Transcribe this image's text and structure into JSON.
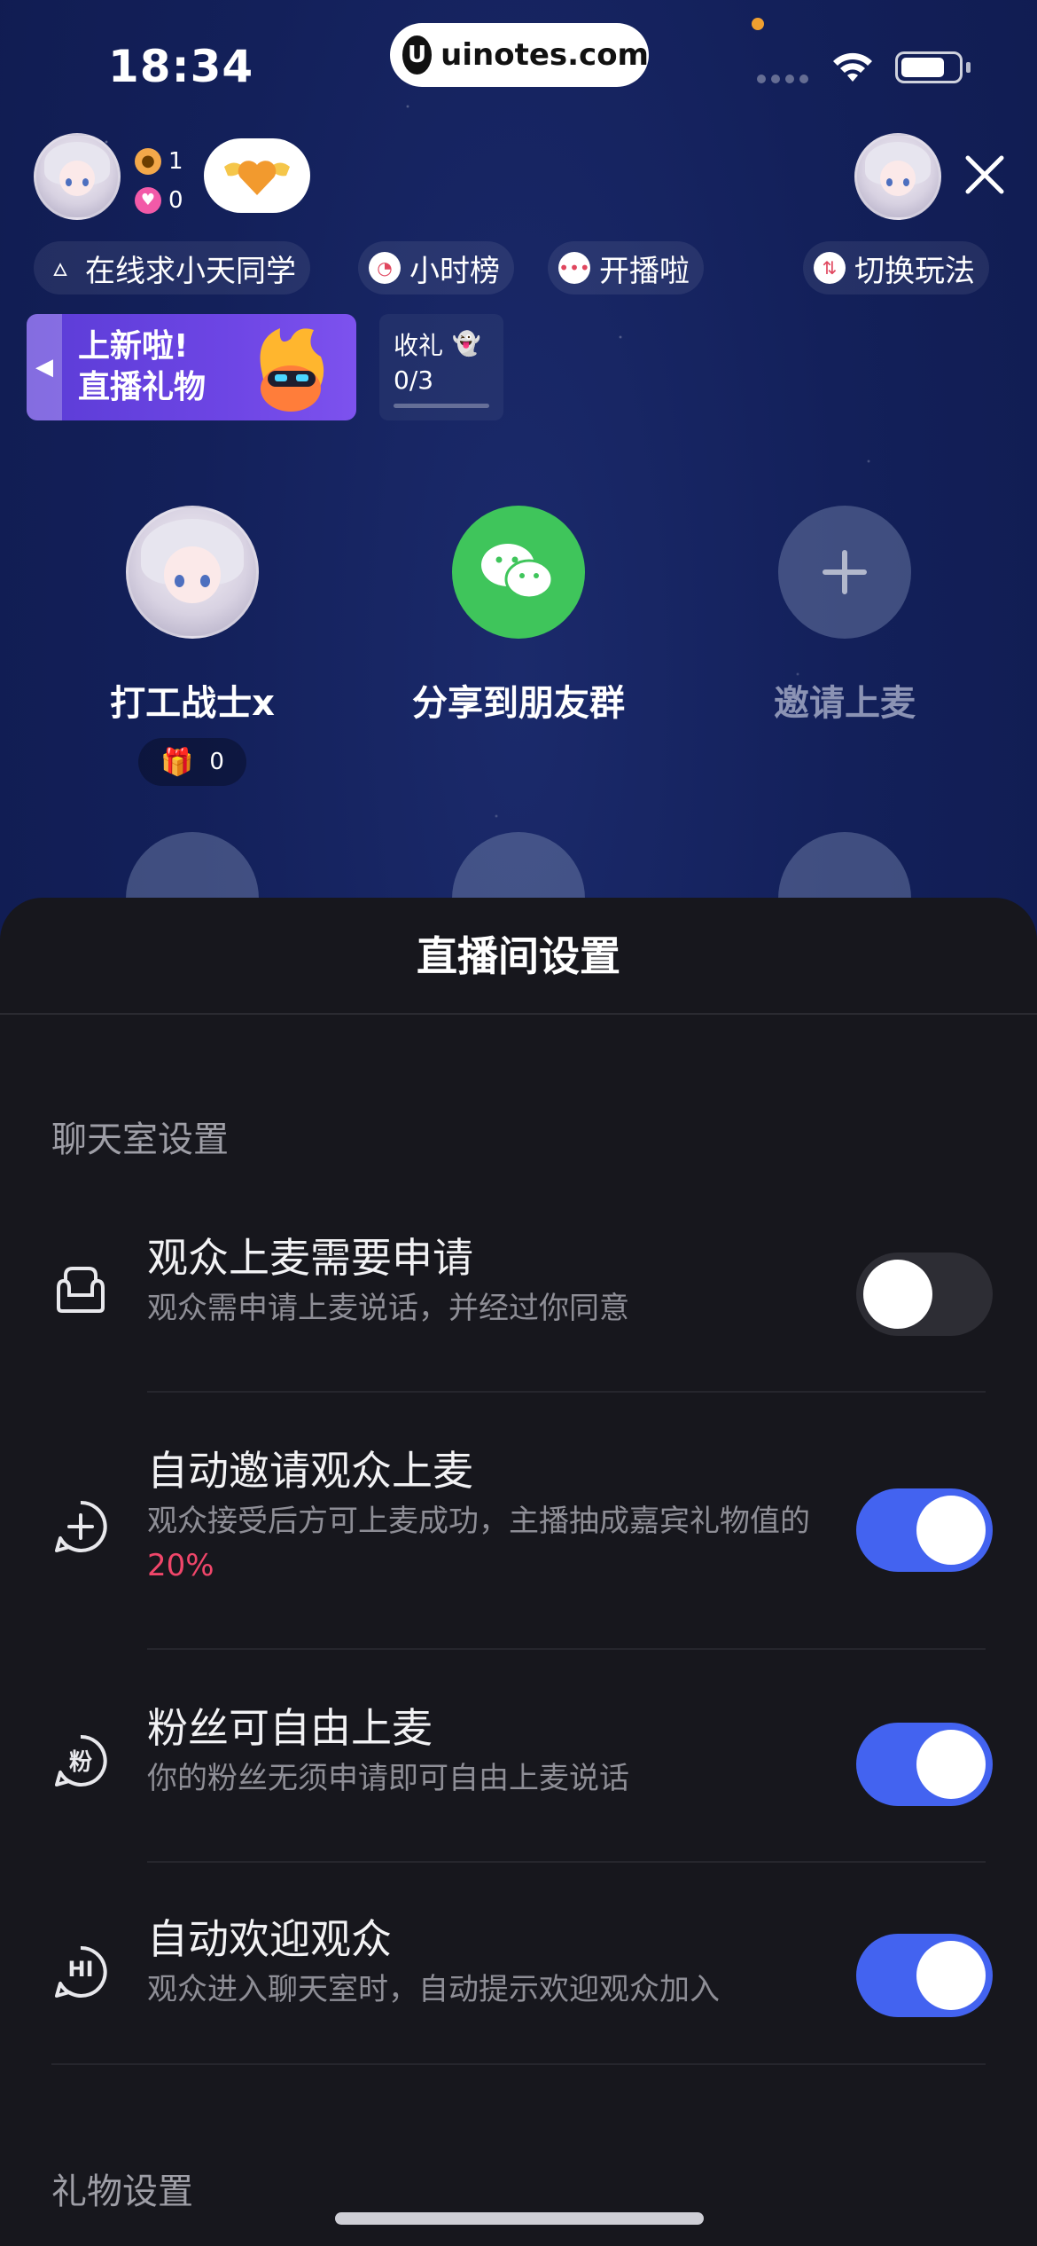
{
  "status_bar": {
    "time": "18:34",
    "url": "uinotes.com",
    "url_logo": "U"
  },
  "host": {
    "online_count": "1",
    "like_count": "0"
  },
  "chips": [
    {
      "label": "在线求小天同学",
      "icon": "flame-icon"
    },
    {
      "label": "小时榜",
      "icon": "clock-icon"
    },
    {
      "label": "开播啦",
      "icon": "chat-bubble-icon"
    },
    {
      "label": "切换玩法",
      "icon": "switch-icon"
    }
  ],
  "banner": {
    "line1": "上新啦!",
    "line2": "直播礼物"
  },
  "gift_goal": {
    "label": "收礼",
    "progress_text": "0/3",
    "progress": 0
  },
  "seats": [
    {
      "name": "打工战士x",
      "gift_count": "0"
    },
    {
      "name": "分享到朋友群"
    },
    {
      "name": "邀请上麦"
    }
  ],
  "sheet": {
    "title": "直播间设置",
    "section_chat": "聊天室设置",
    "section_gift": "礼物设置",
    "settings": [
      {
        "title": "观众上麦需要申请",
        "desc": "观众需申请上麦说话，并经过你同意",
        "enabled": false,
        "icon": "sofa-icon"
      },
      {
        "title": "自动邀请观众上麦",
        "desc": "观众接受后方可上麦成功，主播抽成嘉宾礼物值的",
        "desc_highlight": "20%",
        "enabled": true,
        "icon": "chat-plus-icon"
      },
      {
        "title": "粉丝可自由上麦",
        "desc": "你的粉丝无须申请即可自由上麦说话",
        "enabled": true,
        "icon": "fan-chat-icon",
        "icon_text": "粉"
      },
      {
        "title": "自动欢迎观众",
        "desc": "观众进入聊天室时，自动提示欢迎观众加入",
        "enabled": true,
        "icon": "hi-chat-icon",
        "icon_text": "HI"
      }
    ]
  },
  "colors": {
    "accent": "#4363f0",
    "highlight": "#f0466a",
    "wechat": "#3fc55b",
    "sheet_bg": "#17171d"
  }
}
